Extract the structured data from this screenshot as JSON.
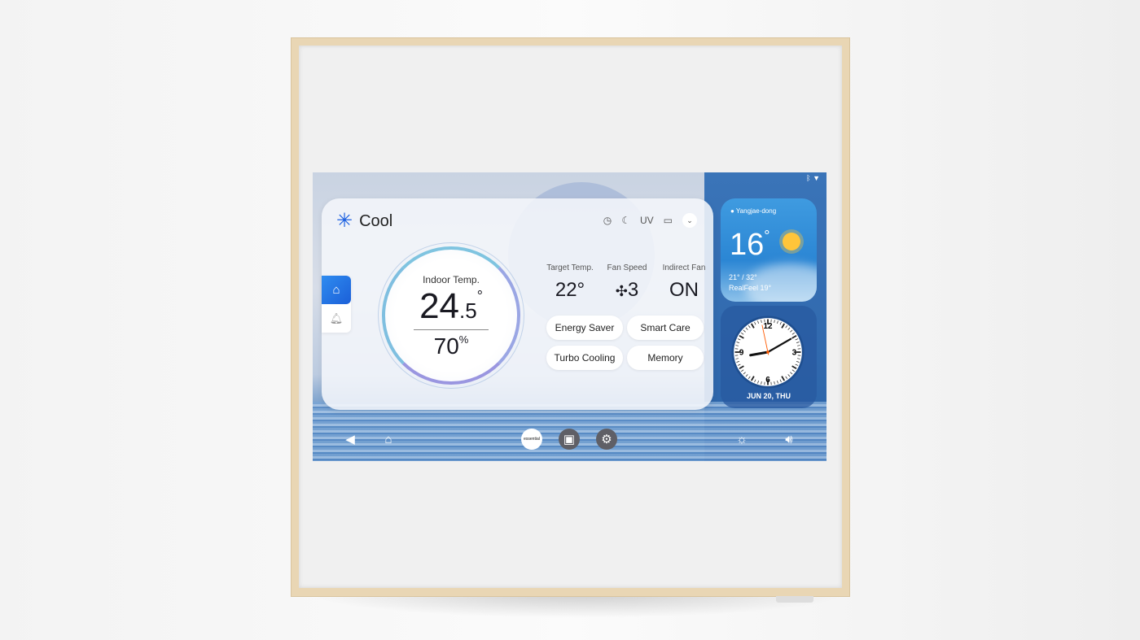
{
  "status": {
    "icons": [
      "bluetooth-icon",
      "wifi-icon"
    ]
  },
  "mode": {
    "label": "Cool",
    "icon": "snowflake-icon",
    "accent": "#1a5fe0"
  },
  "top_icons": [
    "timer-icon",
    "sleep-icon",
    "uv-icon",
    "filter-icon",
    "chevron-down-icon"
  ],
  "uv_label": "UV",
  "indoor": {
    "label": "Indoor Temp.",
    "temp_int": "24",
    "temp_dec": ".5",
    "deg": "°",
    "humidity": "70",
    "pct": "%"
  },
  "stats": [
    {
      "title": "Target Temp.",
      "value": "22°"
    },
    {
      "title": "Fan Speed",
      "value": "3"
    },
    {
      "title": "Indirect Fan",
      "value": "ON"
    }
  ],
  "buttons": [
    "Energy Saver",
    "Smart Care",
    "Turbo Cooling",
    "Memory"
  ],
  "weather": {
    "location": "Yangjae-dong",
    "temp": "16",
    "deg": "°",
    "range": "21° / 32°",
    "realfeel": "RealFeel 19°",
    "condition": "sunny"
  },
  "clock": {
    "hour": 9,
    "minute": 10,
    "second": 58,
    "labels": [
      "12",
      "3",
      "6",
      "9"
    ],
    "date": "JUN 20, THU"
  },
  "nav": {
    "essential_label": "essential"
  }
}
